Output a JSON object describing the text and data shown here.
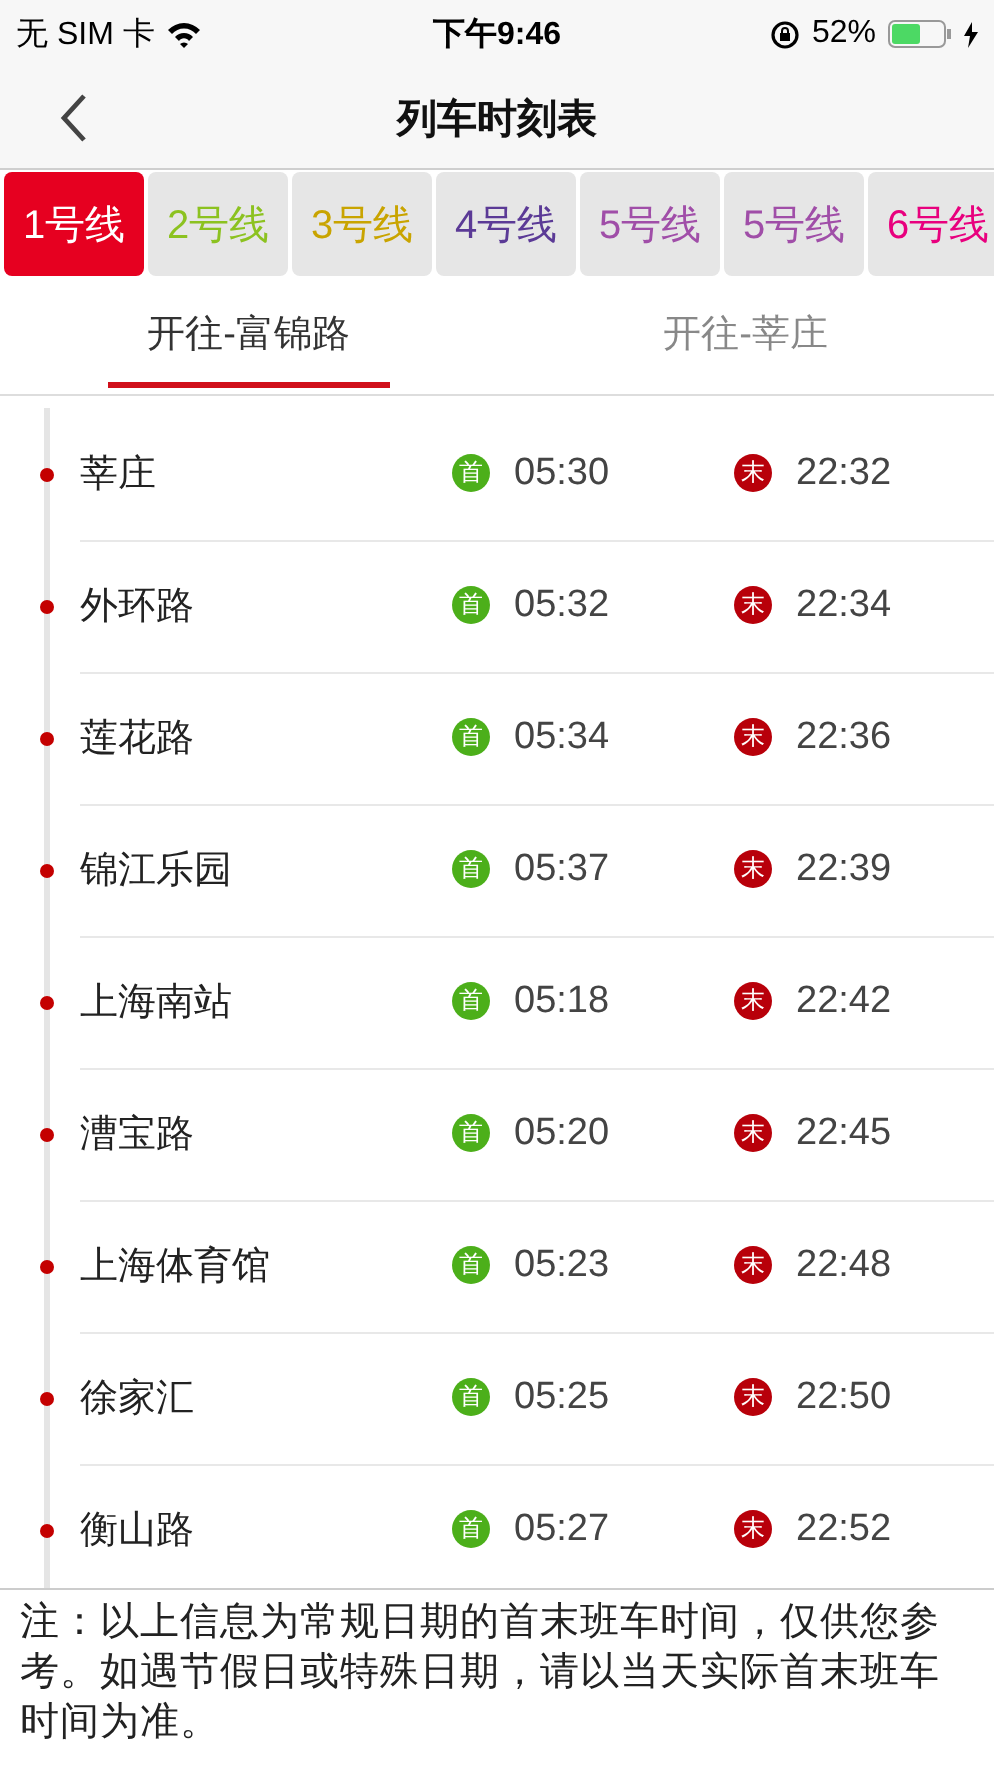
{
  "status_bar": {
    "carrier": "无 SIM 卡",
    "time": "下午9:46",
    "battery": "52%"
  },
  "nav": {
    "title": "列车时刻表"
  },
  "lines": [
    {
      "label": "1号线",
      "color": "#e60020",
      "selected": true
    },
    {
      "label": "2号线",
      "color": "#8cc220",
      "selected": false
    },
    {
      "label": "3号线",
      "color": "#c9a400",
      "selected": false
    },
    {
      "label": "4号线",
      "color": "#5b3a96",
      "selected": false
    },
    {
      "label": "5号线",
      "color": "#a04ea8",
      "selected": false
    },
    {
      "label": "5号线",
      "color": "#a04ea8",
      "selected": false
    },
    {
      "label": "6号线",
      "color": "#e8007e",
      "selected": false
    }
  ],
  "directions": [
    {
      "label": "开往-富锦路",
      "selected": true
    },
    {
      "label": "开往-莘庄",
      "selected": false
    }
  ],
  "stations": [
    {
      "name": "莘庄",
      "first_mark": "首",
      "first": "05:30",
      "last_mark": "末",
      "last": "22:32"
    },
    {
      "name": "外环路",
      "first_mark": "首",
      "first": "05:32",
      "last_mark": "末",
      "last": "22:34"
    },
    {
      "name": "莲花路",
      "first_mark": "首",
      "first": "05:34",
      "last_mark": "末",
      "last": "22:36"
    },
    {
      "name": "锦江乐园",
      "first_mark": "首",
      "first": "05:37",
      "last_mark": "末",
      "last": "22:39"
    },
    {
      "name": "上海南站",
      "first_mark": "首",
      "first": "05:18",
      "last_mark": "末",
      "last": "22:42"
    },
    {
      "name": "漕宝路",
      "first_mark": "首",
      "first": "05:20",
      "last_mark": "末",
      "last": "22:45"
    },
    {
      "name": "上海体育馆",
      "first_mark": "首",
      "first": "05:23",
      "last_mark": "末",
      "last": "22:48"
    },
    {
      "name": "徐家汇",
      "first_mark": "首",
      "first": "05:25",
      "last_mark": "末",
      "last": "22:50"
    },
    {
      "name": "衡山路",
      "first_mark": "首",
      "first": "05:27",
      "last_mark": "末",
      "last": "22:52"
    }
  ],
  "note": "注：以上信息为常规日期的首末班车时间，仅供您参考。如遇节假日或特殊日期，请以当天实际首末班车时间为准。"
}
